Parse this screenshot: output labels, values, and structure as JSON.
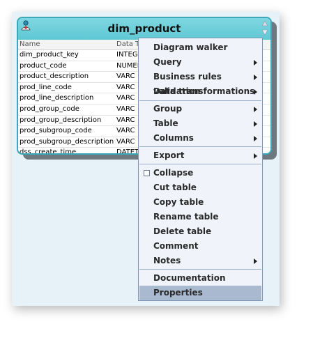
{
  "table": {
    "title": "dim_product",
    "col_headers": {
      "name": "Name",
      "type": "Data T"
    },
    "rows": [
      {
        "name": "dim_product_key",
        "type": "INTEGE"
      },
      {
        "name": "product_code",
        "type": "NUMER"
      },
      {
        "name": "product_description",
        "type": "VARC"
      },
      {
        "name": "prod_line_code",
        "type": "VARC"
      },
      {
        "name": "prod_line_description",
        "type": "VARC"
      },
      {
        "name": "prod_group_code",
        "type": "VARC"
      },
      {
        "name": "prod_group_description",
        "type": "VARC"
      },
      {
        "name": "prod_subgroup_code",
        "type": "VARC"
      },
      {
        "name": "prod_subgroup_description",
        "type": "VARC"
      },
      {
        "name": "dss_create_time",
        "type": "DATET"
      }
    ]
  },
  "menu": {
    "diagram_walker": "Diagram walker",
    "query": "Query",
    "business_rules_validation": "Business rules validation",
    "data_transformations": "Data transformations",
    "group": "Group",
    "table": "Table",
    "columns": "Columns",
    "export": "Export",
    "collapse": "Collapse",
    "cut_table": "Cut table",
    "copy_table": "Copy table",
    "rename_table": "Rename table",
    "delete_table": "Delete table",
    "comment": "Comment",
    "notes": "Notes",
    "documentation": "Documentation",
    "properties": "Properties"
  },
  "colors": {
    "header_teal": "#5ec8d4",
    "menu_bg": "#f0f3f9",
    "menu_selected": "#a9b9d0",
    "canvas_bg": "#e6f2f8"
  }
}
